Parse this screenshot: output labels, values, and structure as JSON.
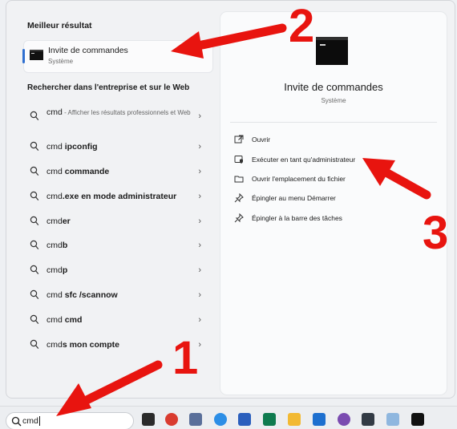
{
  "start_menu": {
    "best_match_title": "Meilleur résultat",
    "best_match": {
      "name": "Invite de commandes",
      "type": "Système",
      "icon": "cmd-icon"
    },
    "search_section_title": "Rechercher dans l'entreprise et sur le Web",
    "results": [
      {
        "prefix": "cmd",
        "bold": "",
        "desc": " - Afficher les résultats professionnels et Web"
      },
      {
        "prefix": "cmd ",
        "bold": "ipconfig",
        "desc": ""
      },
      {
        "prefix": "cmd ",
        "bold": "commande",
        "desc": ""
      },
      {
        "prefix": "cmd",
        "bold": ".exe en mode administrateur",
        "desc": ""
      },
      {
        "prefix": "cmd",
        "bold": "er",
        "desc": ""
      },
      {
        "prefix": "cmd",
        "bold": "b",
        "desc": ""
      },
      {
        "prefix": "cmd",
        "bold": "p",
        "desc": ""
      },
      {
        "prefix": "cmd ",
        "bold": "sfc /scannow",
        "desc": ""
      },
      {
        "prefix": "cmd ",
        "bold": "cmd",
        "desc": ""
      },
      {
        "prefix": "cmd",
        "bold": "s mon compte",
        "desc": ""
      }
    ],
    "chevron": "›"
  },
  "detail": {
    "title": "Invite de commandes",
    "subtitle": "Système",
    "actions": [
      {
        "label": "Ouvrir",
        "icon": "open-external-icon"
      },
      {
        "label": "Exécuter en tant qu'administrateur",
        "icon": "shield-admin-icon"
      },
      {
        "label": "Ouvrir l'emplacement du fichier",
        "icon": "folder-icon"
      },
      {
        "label": "Épingler au menu Démarrer",
        "icon": "pin-icon"
      },
      {
        "label": "Épingler à la barre des tâches",
        "icon": "pin-icon"
      }
    ]
  },
  "taskbar": {
    "search_value": "cmd",
    "icons": [
      "task-view-icon",
      "chrome-icon",
      "tool-icon",
      "app-circle-icon",
      "word-icon",
      "app-square-icon",
      "file-explorer-icon",
      "outlook-icon",
      "slack-icon",
      "terminal-icon",
      "chart-app-icon",
      "cmd-icon"
    ]
  },
  "annotations": {
    "step1": "1",
    "step2": "2",
    "step3": "3",
    "color": "#e8140f"
  }
}
